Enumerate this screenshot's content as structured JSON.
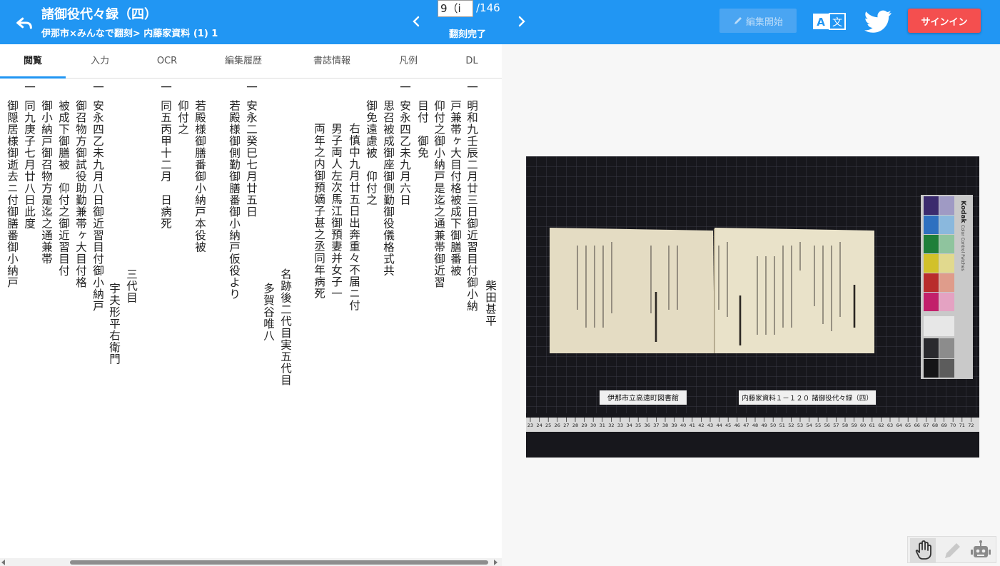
{
  "header": {
    "title": "諸御役代々録（四）",
    "breadcrumb": "伊那市×みんなで翻刻> 内藤家資料 (1) 1",
    "page_current": "9（i",
    "page_total": "/146",
    "status": "翻刻完了",
    "edit_label": "編集開始",
    "signin_label": "サインイン",
    "translate_glyph_a": "A",
    "translate_glyph_b": "文",
    "colors": {
      "bar": "#2196f3",
      "signin": "#f44f4f"
    }
  },
  "tabs": [
    {
      "label": "閲覧",
      "active": true
    },
    {
      "label": "入力"
    },
    {
      "label": "OCR"
    },
    {
      "label": "編集履歴"
    },
    {
      "label": "書誌情報"
    },
    {
      "label": "凡例"
    },
    {
      "label": "DL"
    }
  ],
  "transcription": [
    "一",
    "明和九壬辰二月廿三日御近習目付御小納",
    "戸兼帯ヶ大目付格被成下御膳番被",
    "仰付之御小納戸是迄之通兼帯御近習",
    "目付　御免",
    "一",
    "安永四乙未九月六日",
    "思召被成御座御側勤御役儀格式共",
    "御免遠慮被　仰付之",
    "右慎中九月廿五日出奔重々不届ニ付",
    "男子両人左次馬江御預妻并女子一",
    "両年之内御預嫡子甚之丞同年病死",
    "一",
    "安永二癸巳七月廿五日",
    "若殿様御側勤御膳番御小納戸仮役より",
    "若殿様御膳番御小納戸本役被",
    "仰付之",
    "一",
    "同五丙甲十二月　日病死",
    "一",
    "安永四乙未九月八日御近習目付御小納戸",
    "御召物方御試役助勤兼帯ヶ大目付格",
    "被成下御膳被　仰付之御近習目付",
    "御小納戸御召物方是迄之通兼帯",
    "一",
    "同九庚子七月廿八日此度",
    "御隠居様御逝去ニ付御膳番御小納戸"
  ],
  "signatures": [
    "柴田甚平",
    "名跡後二代目実五代目",
    "多賀谷唯八",
    "三代目",
    "宇夫形平右衛門"
  ],
  "image_labels": {
    "library_card": "伊那市立高遠町図書館",
    "document_card": "内藤家資料１－１２０ 諸御役代々録（四）",
    "color_chart_brand": "Kodak",
    "color_chart_name": "Color Control Patches",
    "ruler_numbers": [
      "23",
      "24",
      "25",
      "26",
      "27",
      "28",
      "29",
      "30",
      "31",
      "32",
      "33",
      "34",
      "35",
      "36",
      "37",
      "38",
      "39",
      "40",
      "41",
      "42",
      "43",
      "44",
      "45",
      "46",
      "47",
      "48",
      "49",
      "50",
      "51",
      "52",
      "53",
      "54",
      "55",
      "56",
      "57",
      "58",
      "59",
      "60",
      "61",
      "62",
      "63",
      "64",
      "65",
      "66",
      "67",
      "68",
      "69",
      "70",
      "71",
      "72"
    ]
  },
  "tools": [
    {
      "name": "hand-tool",
      "active": true
    },
    {
      "name": "pen-tool"
    },
    {
      "name": "robot-tool"
    }
  ]
}
